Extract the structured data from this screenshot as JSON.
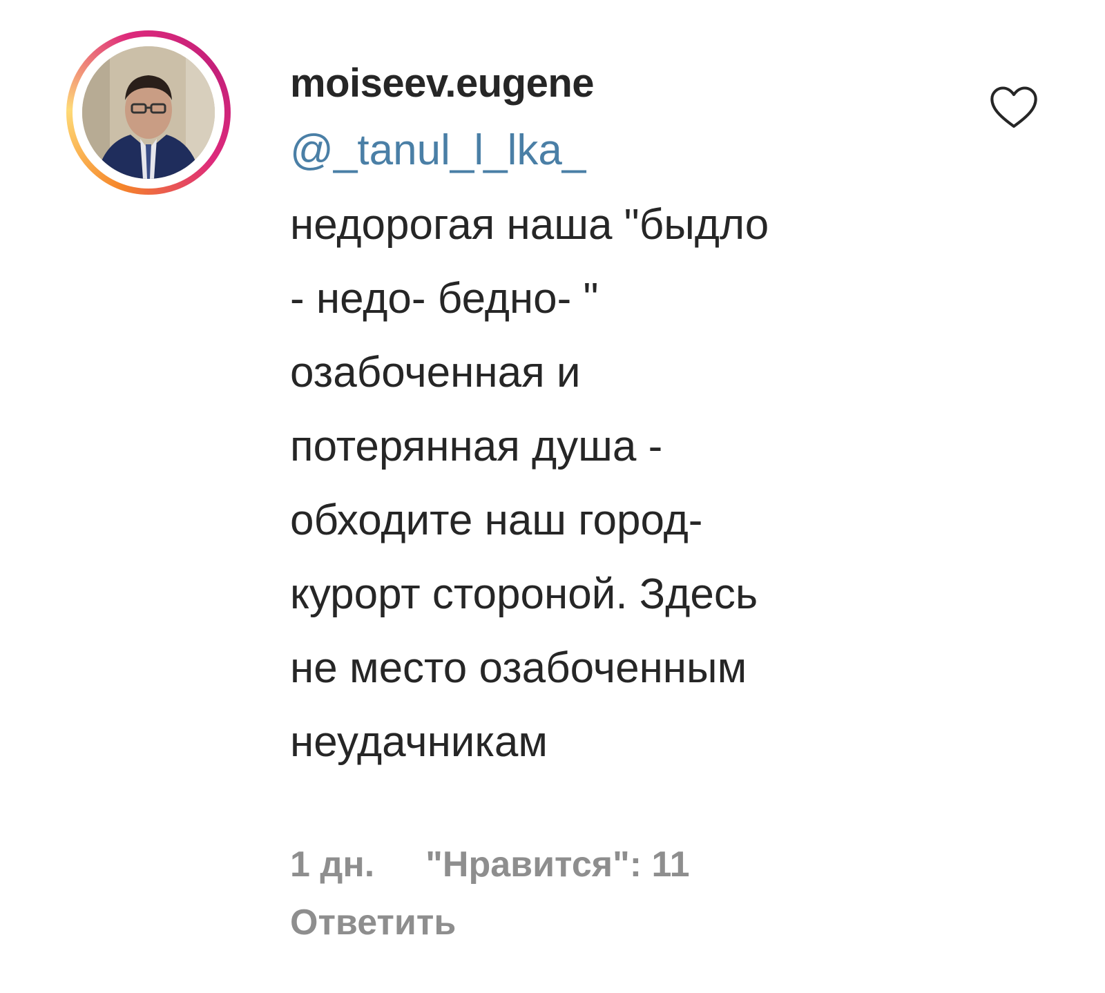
{
  "comment": {
    "username": "moiseev.eugene",
    "mention": "@_tanul_l_lka_",
    "text": "недорогая наша \"быдло\n- недо- бедно- \"\nозабоченная и\nпотерянная душа -\nобходите наш город-\nкурорт стороной. Здесь\nне место озабоченным\nнеудачникам",
    "time": "1 дн.",
    "likes": "\"Нравится\": 11",
    "reply_label": "Ответить",
    "like_icon": "heart-outline-icon"
  },
  "colors": {
    "text": "#262626",
    "mention": "#4a7fa6",
    "meta": "#8e8e8e",
    "ring": "#dd2a7b"
  }
}
